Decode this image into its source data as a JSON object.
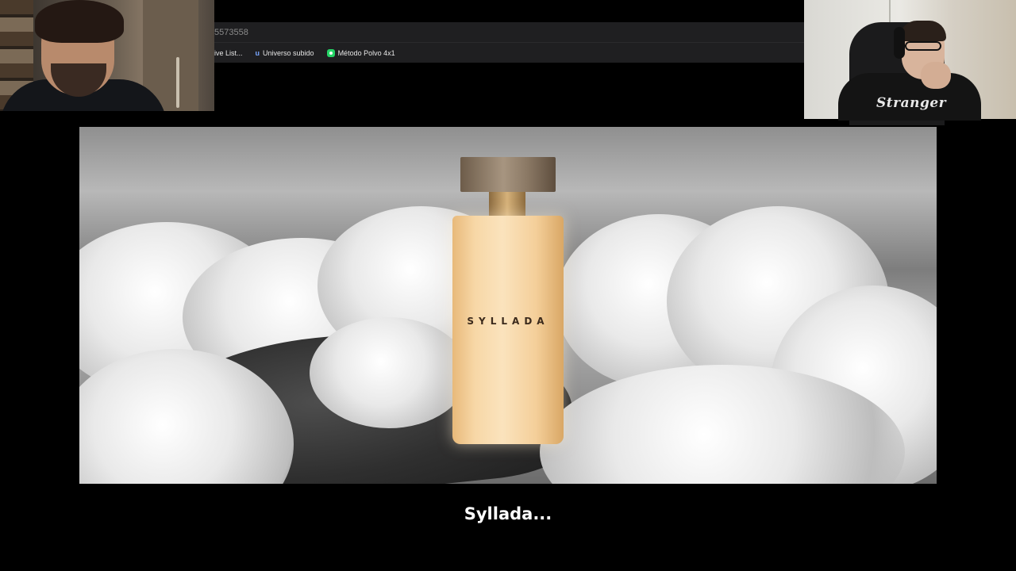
{
  "browser": {
    "address_fragment": "5573558",
    "bookmarks": [
      {
        "label": "ive List...",
        "icon": "document-icon"
      },
      {
        "label": "Universo subido",
        "icon": "u-logo-icon"
      },
      {
        "label": "Método Polvo 4x1",
        "icon": "whatsapp-icon"
      }
    ]
  },
  "webcam_right": {
    "shirt_text": "Stranger"
  },
  "video": {
    "product_label": "SYLLADA"
  },
  "subtitle": {
    "text": "Syllada..."
  },
  "colors": {
    "background": "#000000",
    "bottle_liquid": "#f7d7a6",
    "bottle_cap": "#a79580",
    "subtitle_text": "#ffffff"
  }
}
